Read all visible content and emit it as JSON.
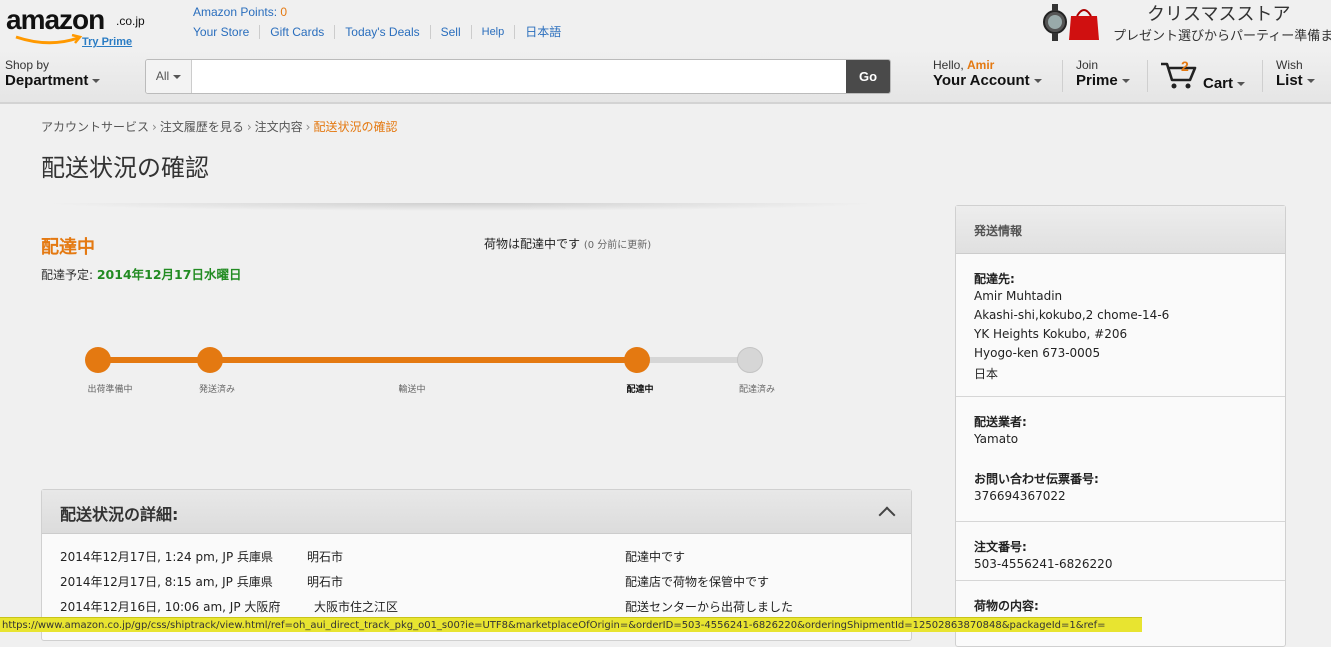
{
  "header": {
    "logo_text": "amazon",
    "logo_tld": ".co.jp",
    "try_prime": "Try Prime",
    "points_label": "Amazon Points: ",
    "points_value": "0",
    "links": [
      "Your Store",
      "Gift Cards",
      "Today's Deals",
      "Sell",
      "Help",
      "日本語"
    ],
    "promo_title": "クリスマスストア",
    "promo_sub": "プレゼント選びからパーティー準備まで"
  },
  "nav": {
    "shop_by_l1": "Shop by",
    "shop_by_l2": "Department",
    "search_category": "All",
    "search_value": "",
    "search_placeholder": "",
    "go_label": "Go",
    "hello": "Hello, ",
    "user_name": "Amir",
    "account": "Your Account",
    "join": "Join",
    "prime": "Prime",
    "cart_count": "2",
    "cart": "Cart",
    "wish": "Wish",
    "list": "List"
  },
  "breadcrumb": [
    "アカウントサービス",
    "注文履歴を見る",
    "注文内容",
    "配送状況の確認"
  ],
  "page_title": "配送状況の確認",
  "status": {
    "heading": "配達中",
    "eta_label": "配達予定: ",
    "eta_date": "2014年12月17日水曜日",
    "package_message": "荷物は配達中です",
    "updated": "(0 分前に更新)"
  },
  "tracker": {
    "stages": [
      {
        "label": "出荷準備中",
        "state": "done"
      },
      {
        "label": "発送済み",
        "state": "done"
      },
      {
        "label": "輸送中",
        "state": "done"
      },
      {
        "label": "配達中",
        "state": "current"
      },
      {
        "label": "配達済み",
        "state": "pending"
      }
    ],
    "progress_color": "#e47911",
    "pending_color": "#d6d6d6"
  },
  "details": {
    "title": "配送状況の詳細:",
    "rows": [
      {
        "when": "2014年12月17日, 1:24 pm, JP 兵庫県",
        "city": "明石市",
        "event": "配達中です"
      },
      {
        "when": "2014年12月17日, 8:15 am, JP 兵庫県",
        "city": "明石市",
        "event": "配達店で荷物を保管中です"
      },
      {
        "when": "2014年12月16日, 10:06 am, JP 大阪府",
        "city": "大阪市住之江区",
        "event": "配送センターから出荷しました"
      }
    ]
  },
  "shipping_info": {
    "title": "発送情報",
    "ship_to_label": "配達先:",
    "ship_to": [
      "Amir Muhtadin",
      "Akashi-shi,kokubo,2 chome-14-6",
      "YK Heights Kokubo, #206",
      "Hyogo-ken 673-0005",
      "日本"
    ],
    "carrier_label": "配送業者:",
    "carrier": "Yamato",
    "tracking_label": "お問い合わせ伝票番号:",
    "tracking": "376694367022",
    "order_label": "注文番号:",
    "order": "503-4556241-6826220",
    "contents_label": "荷物の内容:"
  },
  "status_bar_url": "https://www.amazon.co.jp/gp/css/shiptrack/view.html/ref=oh_aui_direct_track_pkg_o01_s00?ie=UTF8&marketplaceOfOrigin=&orderID=503-4556241-6826220&orderingShipmentId=12502863870848&packageId=1&ref="
}
